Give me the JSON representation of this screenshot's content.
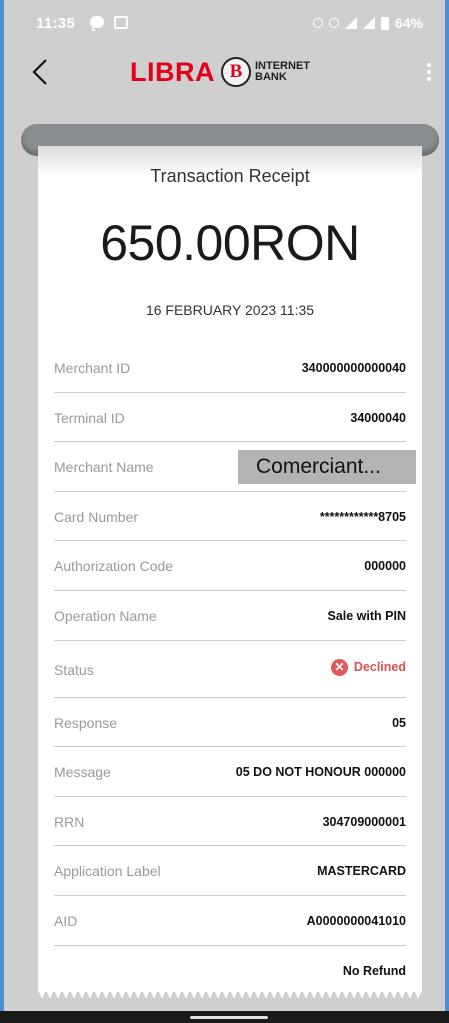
{
  "status_bar": {
    "time": "11:35",
    "battery_percent": "64%"
  },
  "header": {
    "logo_word": "LIBRA",
    "logo_letter": "B",
    "logo_sub_line1": "INTERNET",
    "logo_sub_line2": "BANK",
    "brand_color": "#e3001b"
  },
  "receipt": {
    "title": "Transaction Receipt",
    "amount": "650.00RON",
    "date": "16 FEBRUARY 2023 11:35",
    "rows": [
      {
        "label": "Merchant ID",
        "value": "340000000000040"
      },
      {
        "label": "Terminal ID",
        "value": "34000040"
      },
      {
        "label": "Merchant Name",
        "value": "Comerciant..."
      },
      {
        "label": "Card Number",
        "value": "************8705"
      },
      {
        "label": "Authorization Code",
        "value": "000000"
      },
      {
        "label": "Operation Name",
        "value": "Sale with PIN"
      },
      {
        "label": "Status",
        "value": "Declined"
      },
      {
        "label": "Response",
        "value": "05"
      },
      {
        "label": "Message",
        "value": "05 DO NOT HONOUR 000000"
      },
      {
        "label": "RRN",
        "value": "304709000001"
      },
      {
        "label": "Application Label",
        "value": "MASTERCARD"
      },
      {
        "label": "AID",
        "value": "A0000000041010"
      },
      {
        "label": "",
        "value": "No Refund"
      }
    ],
    "status_color": "#d9534f"
  }
}
